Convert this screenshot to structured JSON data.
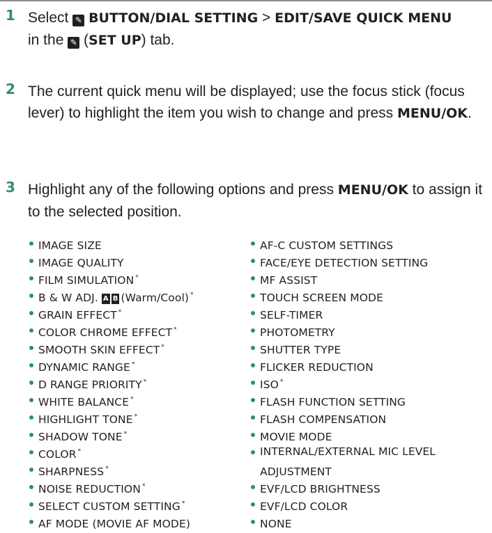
{
  "steps": [
    {
      "number": "1",
      "pre": "Select",
      "icon_glyph": "✎",
      "menu_path_a": "BUTTON/DIAL SETTING",
      "separator": ">",
      "menu_path_b": "EDIT/SAVE QUICK MENU",
      "in_the": "in the",
      "tab_name": "SET UP",
      "tab_suffix": "tab."
    },
    {
      "number": "2",
      "text": "The current quick menu will be displayed; use the focus stick (focus lever) to highlight the item you wish to change and press",
      "button": "MENU/OK",
      "end": "."
    },
    {
      "number": "3",
      "text": "Highlight any of the following options and press",
      "button": "MENU/OK",
      "end": "to assign it to the selected position."
    }
  ],
  "left_options": [
    {
      "label": "IMAGE SIZE",
      "note": ""
    },
    {
      "label": "IMAGE QUALITY",
      "note": ""
    },
    {
      "label": "FILM SIMULATION",
      "note": "*"
    },
    {
      "label": "B & W ADJ.",
      "icon_a": "A",
      "icon_b": "B",
      "suffix": "(Warm/Cool)",
      "note": "*"
    },
    {
      "label": "GRAIN EFFECT",
      "note": "*"
    },
    {
      "label": "COLOR CHROME EFFECT",
      "note": "*"
    },
    {
      "label": "SMOOTH SKIN EFFECT",
      "note": "*"
    },
    {
      "label": "DYNAMIC RANGE",
      "note": "*"
    },
    {
      "label": "D RANGE PRIORITY",
      "note": "*"
    },
    {
      "label": "WHITE BALANCE",
      "note": "*"
    },
    {
      "label": "HIGHLIGHT TONE",
      "note": "*"
    },
    {
      "label": "SHADOW TONE",
      "note": "*"
    },
    {
      "label": "COLOR",
      "note": "*"
    },
    {
      "label": "SHARPNESS",
      "note": "*"
    },
    {
      "label": "NOISE REDUCTION",
      "note": "*"
    },
    {
      "label": "SELECT CUSTOM SETTING",
      "note": "*"
    },
    {
      "label": "AF MODE (MOVIE AF MODE)",
      "note": ""
    }
  ],
  "right_options": [
    {
      "label": "AF-C CUSTOM SETTINGS",
      "note": ""
    },
    {
      "label": "FACE/EYE DETECTION SETTING",
      "note": ""
    },
    {
      "label": "MF ASSIST",
      "note": ""
    },
    {
      "label": "TOUCH SCREEN MODE",
      "note": ""
    },
    {
      "label": "SELF-TIMER",
      "note": ""
    },
    {
      "label": "PHOTOMETRY",
      "note": ""
    },
    {
      "label": "SHUTTER TYPE",
      "note": ""
    },
    {
      "label": "FLICKER REDUCTION",
      "note": ""
    },
    {
      "label": "ISO",
      "note": "*"
    },
    {
      "label": "FLASH FUNCTION SETTING",
      "note": ""
    },
    {
      "label": "FLASH COMPENSATION",
      "note": ""
    },
    {
      "label": "MOVIE MODE",
      "note": ""
    },
    {
      "label": "INTERNAL/EXTERNAL MIC LEVEL",
      "label2": "ADJUSTMENT",
      "note": ""
    },
    {
      "label": "EVF/LCD BRIGHTNESS",
      "note": ""
    },
    {
      "label": "EVF/LCD COLOR",
      "note": ""
    },
    {
      "label": "NONE",
      "note": ""
    }
  ],
  "colors": {
    "accent": "#2f8f6b",
    "text": "#231f20"
  }
}
